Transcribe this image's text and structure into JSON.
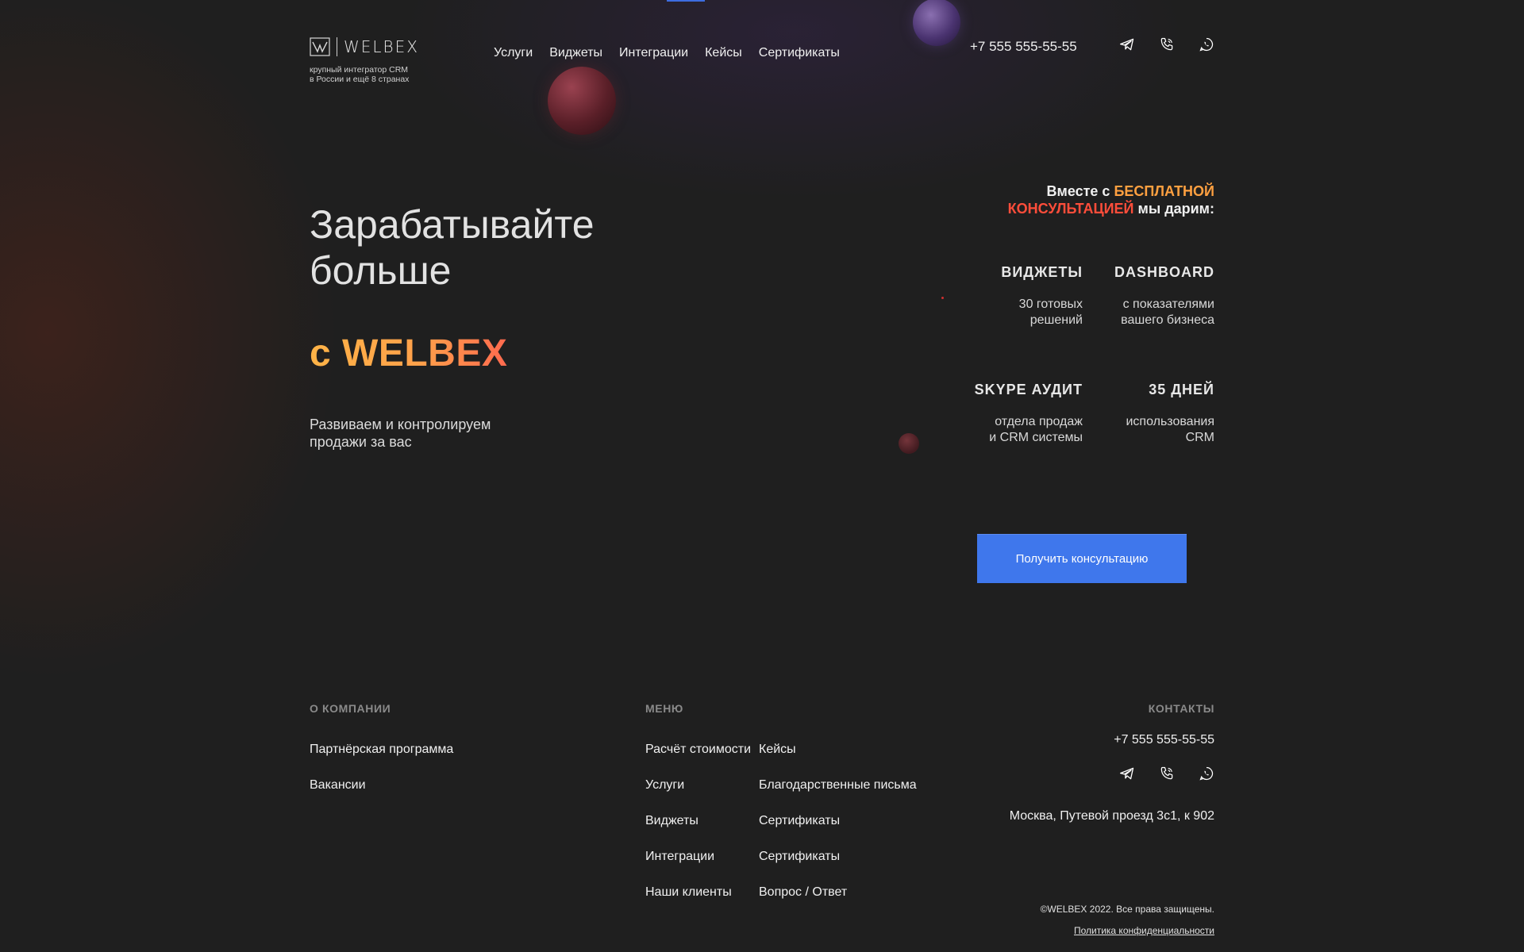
{
  "header": {
    "logo_text": "WELBEX",
    "tagline_line1": "крупный интегратор CRM",
    "tagline_line2": "в России и ещё 8 странах",
    "nav": [
      "Услуги",
      "Виджеты",
      "Интеграции",
      "Кейсы",
      "Сертификаты"
    ],
    "phone": "+7 555 555-55-55",
    "social_icons": [
      "telegram-icon",
      "phone-icon",
      "whatsapp-icon"
    ]
  },
  "hero": {
    "title_line1": "Зарабатывайте",
    "title_line2": "больше",
    "brand": "с WELBEX",
    "subtitle_line1": "Развиваем и контролируем",
    "subtitle_line2": "продажи за вас"
  },
  "offer": {
    "prefix": "Вместе с",
    "highlight1": "БЕСПЛАТНОЙ",
    "highlight2": "КОНСУЛЬТАЦИЕЙ",
    "suffix": "мы дарим:",
    "features": [
      {
        "title": "ВИДЖЕТЫ",
        "desc_line1": "30 готовых",
        "desc_line2": "решений"
      },
      {
        "title": "DASHBOARD",
        "desc_line1": "с показателями",
        "desc_line2": "вашего бизнеса"
      },
      {
        "title": "SKYPE АУДИТ",
        "desc_line1": "отдела продаж",
        "desc_line2": "и CRM системы"
      },
      {
        "title": "35 ДНЕЙ",
        "desc_line1": "использования",
        "desc_line2": "CRM"
      }
    ],
    "cta_label": "Получить консультацию"
  },
  "footer": {
    "about_heading": "О КОМПАНИИ",
    "about_links": [
      "Партнёрская программа",
      "Вакансии"
    ],
    "menu_heading": "МЕНЮ",
    "menu_col1": [
      "Расчёт стоимости",
      "Услуги",
      "Виджеты",
      "Интеграции",
      "Наши клиенты"
    ],
    "menu_col2": [
      "Кейсы",
      "Благодарственные письма",
      "Сертификаты",
      "Сертификаты",
      "Вопрос / Ответ"
    ],
    "contacts_heading": "КОНТАКТЫ",
    "phone": "+7 555 555-55-55",
    "address": "Москва, Путевой проезд 3с1, к 902",
    "copyright": "©WELBEX 2022. Все права защищены.",
    "policy": "Политика конфиденциальности"
  },
  "colors": {
    "background": "#1f1f1f",
    "accent_blue": "#3f77ec",
    "accent_orange": "#ffa040",
    "accent_red": "#ff4d3a"
  }
}
